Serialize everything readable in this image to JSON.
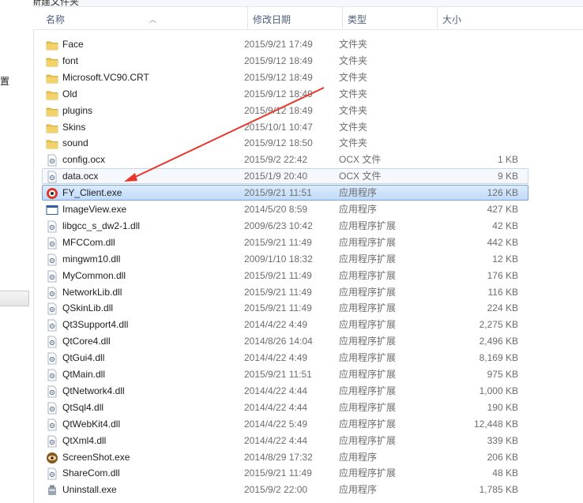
{
  "toolbar": {
    "partial_label": "新建文件夹"
  },
  "nav": {
    "partial_label": "设置"
  },
  "columns": {
    "name": "名称",
    "date": "修改日期",
    "type": "类型",
    "size": "大小"
  },
  "files": [
    {
      "name": "Face",
      "date": "2015/9/21 17:49",
      "type": "文件夹",
      "size": "",
      "icon": "folder-icon"
    },
    {
      "name": "font",
      "date": "2015/9/12 18:49",
      "type": "文件夹",
      "size": "",
      "icon": "folder-icon"
    },
    {
      "name": "Microsoft.VC90.CRT",
      "date": "2015/9/12 18:49",
      "type": "文件夹",
      "size": "",
      "icon": "folder-icon"
    },
    {
      "name": "Old",
      "date": "2015/9/12 18:49",
      "type": "文件夹",
      "size": "",
      "icon": "folder-icon"
    },
    {
      "name": "plugins",
      "date": "2015/9/12 18:49",
      "type": "文件夹",
      "size": "",
      "icon": "folder-icon"
    },
    {
      "name": "Skins",
      "date": "2015/10/1 10:47",
      "type": "文件夹",
      "size": "",
      "icon": "folder-icon"
    },
    {
      "name": "sound",
      "date": "2015/9/12 18:50",
      "type": "文件夹",
      "size": "",
      "icon": "folder-icon"
    },
    {
      "name": "config.ocx",
      "date": "2015/9/2 22:42",
      "type": "OCX 文件",
      "size": "1 KB",
      "icon": "gear-file-icon"
    },
    {
      "name": "data.ocx",
      "date": "2015/1/9 20:40",
      "type": "OCX 文件",
      "size": "9 KB",
      "icon": "gear-file-icon"
    },
    {
      "name": "FY_Client.exe",
      "date": "2015/9/21 11:51",
      "type": "应用程序",
      "size": "126 KB",
      "icon": "app-logo-icon"
    },
    {
      "name": "ImageView.exe",
      "date": "2014/5/20 8:59",
      "type": "应用程序",
      "size": "427 KB",
      "icon": "window-icon"
    },
    {
      "name": "libgcc_s_dw2-1.dll",
      "date": "2009/6/23 10:42",
      "type": "应用程序扩展",
      "size": "42 KB",
      "icon": "gear-file-icon"
    },
    {
      "name": "MFCCom.dll",
      "date": "2015/9/21 11:49",
      "type": "应用程序扩展",
      "size": "442 KB",
      "icon": "gear-file-icon"
    },
    {
      "name": "mingwm10.dll",
      "date": "2009/1/10 18:32",
      "type": "应用程序扩展",
      "size": "12 KB",
      "icon": "gear-file-icon"
    },
    {
      "name": "MyCommon.dll",
      "date": "2015/9/21 11:49",
      "type": "应用程序扩展",
      "size": "176 KB",
      "icon": "gear-file-icon"
    },
    {
      "name": "NetworkLib.dll",
      "date": "2015/9/21 11:49",
      "type": "应用程序扩展",
      "size": "116 KB",
      "icon": "gear-file-icon"
    },
    {
      "name": "QSkinLib.dll",
      "date": "2015/9/21 11:49",
      "type": "应用程序扩展",
      "size": "224 KB",
      "icon": "gear-file-icon"
    },
    {
      "name": "Qt3Support4.dll",
      "date": "2014/4/22 4:49",
      "type": "应用程序扩展",
      "size": "2,275 KB",
      "icon": "gear-file-icon"
    },
    {
      "name": "QtCore4.dll",
      "date": "2014/8/26 14:04",
      "type": "应用程序扩展",
      "size": "2,496 KB",
      "icon": "gear-file-icon"
    },
    {
      "name": "QtGui4.dll",
      "date": "2014/4/22 4:49",
      "type": "应用程序扩展",
      "size": "8,169 KB",
      "icon": "gear-file-icon"
    },
    {
      "name": "QtMain.dll",
      "date": "2015/9/21 11:51",
      "type": "应用程序扩展",
      "size": "975 KB",
      "icon": "gear-file-icon"
    },
    {
      "name": "QtNetwork4.dll",
      "date": "2014/4/22 4:44",
      "type": "应用程序扩展",
      "size": "1,000 KB",
      "icon": "gear-file-icon"
    },
    {
      "name": "QtSql4.dll",
      "date": "2014/4/22 4:44",
      "type": "应用程序扩展",
      "size": "190 KB",
      "icon": "gear-file-icon"
    },
    {
      "name": "QtWebKit4.dll",
      "date": "2014/4/22 5:49",
      "type": "应用程序扩展",
      "size": "12,448 KB",
      "icon": "gear-file-icon"
    },
    {
      "name": "QtXml4.dll",
      "date": "2014/4/22 4:44",
      "type": "应用程序扩展",
      "size": "339 KB",
      "icon": "gear-file-icon"
    },
    {
      "name": "ScreenShot.exe",
      "date": "2014/8/29 17:32",
      "type": "应用程序",
      "size": "206 KB",
      "icon": "eye-app-icon"
    },
    {
      "name": "ShareCom.dll",
      "date": "2015/9/21 11:49",
      "type": "应用程序扩展",
      "size": "48 KB",
      "icon": "gear-file-icon"
    },
    {
      "name": "Uninstall.exe",
      "date": "2015/9/2 22:00",
      "type": "应用程序",
      "size": "1,785 KB",
      "icon": "uninstall-icon"
    }
  ],
  "state": {
    "hover_row": 8,
    "selected_row": 9
  },
  "colors": {
    "annotation_arrow": "#e8362b",
    "folder": "#e8c34a",
    "selection": "#c1dbfc"
  }
}
